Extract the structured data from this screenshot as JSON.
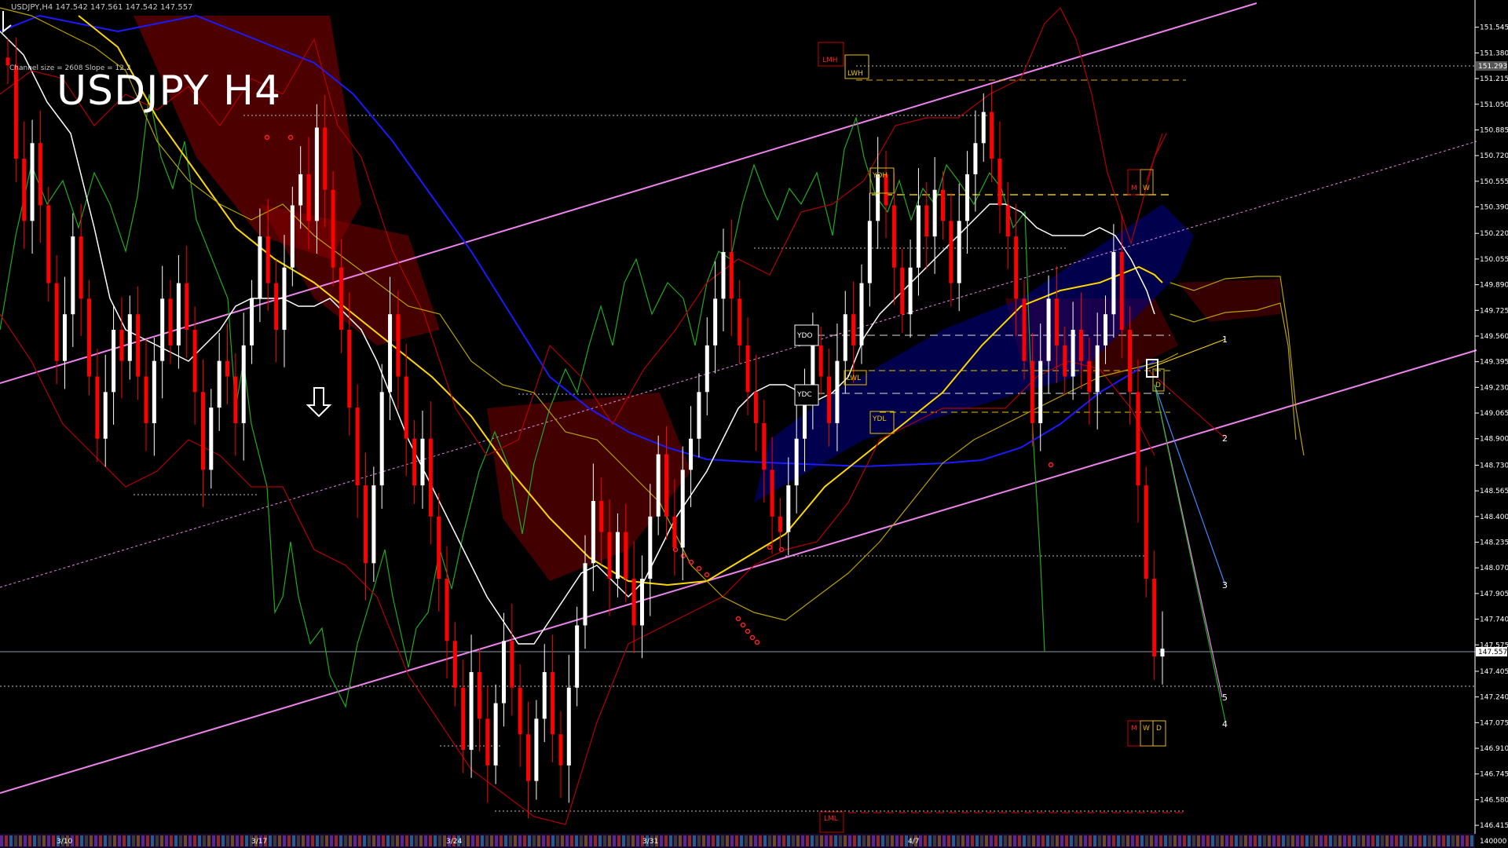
{
  "header": {
    "info": "USDJPY,H4  147.542 147.561 147.542 147.557",
    "channel": "Channel size = 2608 Slope = 12.2",
    "title": "USDJPY H4"
  },
  "colors": {
    "background": "#000000",
    "bull": "#ffffff",
    "bear": "#ff0000",
    "channel": "#ee82ee",
    "yellow": "#ffd700",
    "gold": "#b8a000",
    "green": "#1faa1f",
    "blue": "#1a1aff",
    "darkred": "#b40000",
    "current_price_bg": "#ffffff"
  },
  "chart_data": {
    "type": "candlestick",
    "symbol": "USDJPY",
    "timeframe": "H4",
    "ylim": [
      146.36,
      151.72
    ],
    "price_ticks": [
      151.545,
      151.38,
      151.215,
      151.05,
      150.885,
      150.72,
      150.555,
      150.39,
      150.22,
      150.055,
      149.89,
      149.725,
      149.56,
      149.395,
      149.23,
      149.065,
      148.9,
      148.73,
      148.565,
      148.4,
      148.235,
      148.07,
      147.905,
      147.74,
      147.575,
      147.405,
      147.24,
      147.075,
      146.91,
      146.745,
      146.58,
      146.415
    ],
    "current_price": "147.557",
    "channel_top_label": "151.293",
    "x_labels": [
      "3/10",
      "3/17",
      "3/24",
      "3/31",
      "4/7"
    ],
    "bottom_tag": "140000",
    "level_boxes": [
      "LMH",
      "LWH",
      "YDH",
      "YDO",
      "YDC",
      "LWL",
      "YDL",
      "LML"
    ],
    "period_tags_top": [
      "M",
      "W"
    ],
    "period_tags_bottom": [
      "M",
      "W",
      "D"
    ],
    "mini_tag": "D",
    "wave_labels": [
      "1",
      "2",
      "3",
      "4",
      "5"
    ],
    "closes": [
      151.3,
      150.7,
      150.3,
      150.8,
      150.4,
      149.9,
      149.4,
      149.7,
      150.2,
      149.8,
      149.3,
      148.9,
      149.2,
      149.6,
      149.4,
      149.7,
      149.3,
      149.0,
      149.4,
      149.8,
      149.5,
      149.9,
      149.6,
      149.2,
      148.7,
      149.1,
      149.4,
      149.3,
      149.0,
      149.5,
      149.8,
      150.2,
      149.9,
      149.6,
      150.0,
      150.4,
      150.6,
      150.3,
      150.9,
      150.5,
      150.0,
      149.6,
      149.1,
      148.6,
      148.1,
      148.6,
      149.2,
      149.7,
      149.3,
      148.9,
      148.6,
      148.9,
      148.4,
      148.0,
      147.6,
      147.3,
      146.9,
      147.4,
      147.1,
      146.8,
      147.2,
      147.6,
      147.3,
      147.0,
      146.7,
      147.1,
      147.4,
      147.0,
      146.8,
      147.3,
      147.7,
      148.1,
      148.5,
      148.3,
      148.0,
      148.3,
      148.0,
      147.7,
      148.0,
      148.4,
      148.8,
      148.4,
      148.2,
      148.7,
      148.9,
      149.2,
      149.5,
      149.8,
      150.1,
      149.8,
      149.5,
      149.2,
      149.0,
      148.7,
      148.4,
      148.3,
      148.6,
      148.9,
      149.2,
      149.5,
      149.3,
      149.0,
      149.4,
      149.7,
      149.5,
      149.9,
      150.3,
      150.6,
      150.4,
      150.0,
      149.7,
      150.0,
      150.4,
      150.2,
      150.5,
      150.3,
      149.9,
      150.3,
      150.6,
      150.8,
      151.0,
      150.7,
      150.4,
      150.2,
      149.8,
      149.4,
      149.0,
      149.4,
      149.8,
      149.5,
      149.3,
      149.6,
      149.4,
      149.2,
      149.5,
      149.7,
      150.1,
      149.6,
      149.2,
      148.6,
      148.0,
      147.5,
      147.55
    ]
  }
}
